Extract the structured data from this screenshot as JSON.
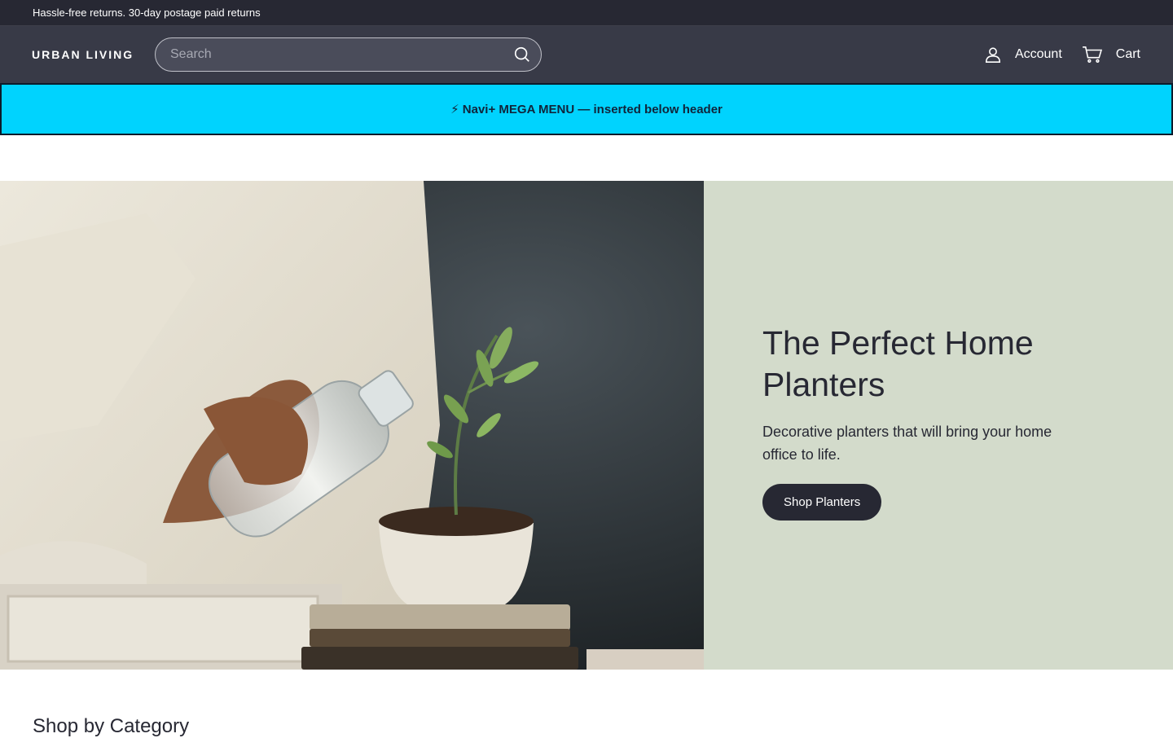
{
  "announcement": {
    "text": "Hassle-free returns. 30-day postage paid returns"
  },
  "header": {
    "logo": "URBAN LIVING",
    "search_placeholder": "Search",
    "account_label": "Account",
    "cart_label": "Cart"
  },
  "mega_menu": {
    "text": "⚡ Navi+ MEGA MENU — inserted below header"
  },
  "hero": {
    "title": "The Perfect Home Planters",
    "description": "Decorative planters that will bring your home office to life.",
    "button_label": "Shop Planters"
  },
  "sections": {
    "category_title": "Shop by Category"
  },
  "colors": {
    "announcement_bg": "#272833",
    "header_bg": "#383a47",
    "mega_banner_bg": "#00d3fe",
    "hero_panel_bg": "#d3dbcb",
    "button_bg": "#272833"
  },
  "icons": {
    "search": "search-icon",
    "account": "user-icon",
    "cart": "cart-icon"
  }
}
